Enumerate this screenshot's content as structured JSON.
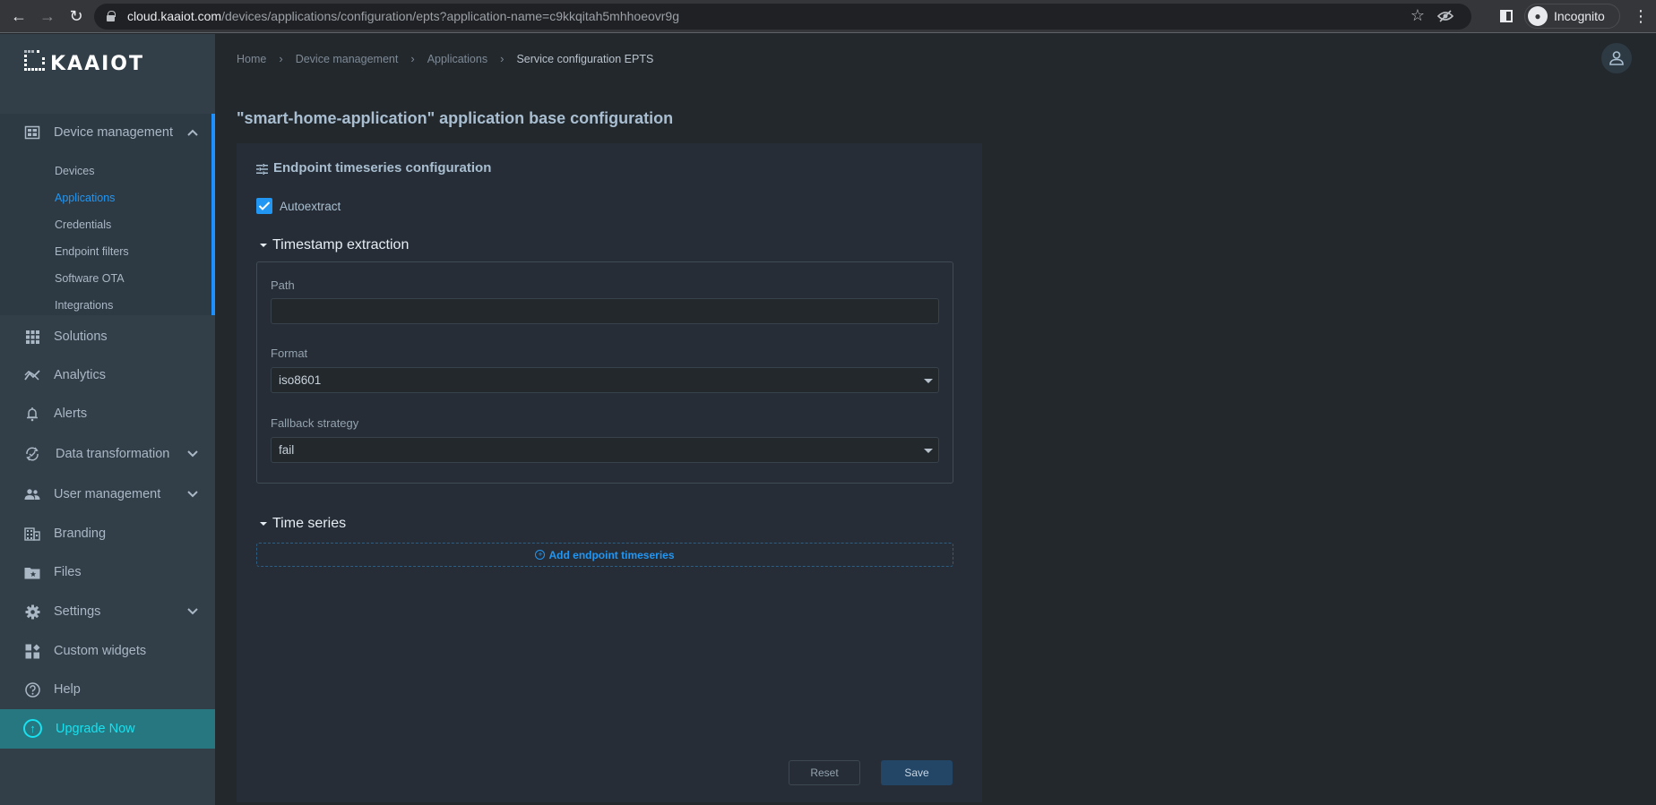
{
  "browser": {
    "url_host": "cloud.kaaiot.com",
    "url_path": "/devices/applications/configuration/epts?application-name=c9kkqitah5mhhoeovr9g",
    "profile_label": "Incognito"
  },
  "logo": {
    "text": "KAAIOT"
  },
  "sidebar": {
    "device_management": {
      "label": "Device management",
      "expanded": true,
      "children": [
        {
          "label": "Devices",
          "active": false
        },
        {
          "label": "Applications",
          "active": true
        },
        {
          "label": "Credentials",
          "active": false
        },
        {
          "label": "Endpoint filters",
          "active": false
        },
        {
          "label": "Software OTA",
          "active": false
        },
        {
          "label": "Integrations",
          "active": false
        }
      ]
    },
    "items": [
      {
        "label": "Solutions",
        "icon": "grid-icon",
        "has_children": false
      },
      {
        "label": "Analytics",
        "icon": "analytics-icon",
        "has_children": false
      },
      {
        "label": "Alerts",
        "icon": "bell-icon",
        "has_children": false
      },
      {
        "label": "Data transformation",
        "icon": "sync-check-icon",
        "has_children": true
      },
      {
        "label": "User management",
        "icon": "users-icon",
        "has_children": true
      },
      {
        "label": "Branding",
        "icon": "building-icon",
        "has_children": false
      },
      {
        "label": "Files",
        "icon": "folder-star-icon",
        "has_children": false
      },
      {
        "label": "Settings",
        "icon": "gear-icon",
        "has_children": true
      },
      {
        "label": "Custom widgets",
        "icon": "widgets-icon",
        "has_children": false
      },
      {
        "label": "Help",
        "icon": "help-icon",
        "has_children": false
      }
    ],
    "upgrade": {
      "label": "Upgrade Now"
    }
  },
  "breadcrumb": [
    "Home",
    "Device management",
    "Applications",
    "Service configuration EPTS"
  ],
  "page": {
    "title": "\"smart-home-application\" application base configuration"
  },
  "card": {
    "title": "Endpoint timeseries configuration",
    "autoextract": {
      "label": "Autoextract",
      "checked": true
    },
    "timestamp_section": {
      "title": "Timestamp extraction",
      "path": {
        "label": "Path",
        "value": ""
      },
      "format": {
        "label": "Format",
        "value": "iso8601"
      },
      "fallback": {
        "label": "Fallback strategy",
        "value": "fail"
      }
    },
    "timeseries_section": {
      "title": "Time series",
      "add_label": "Add endpoint timeseries"
    },
    "reset_label": "Reset",
    "save_label": "Save"
  },
  "colors": {
    "accent": "#2196f3",
    "upgrade_bg": "#26777f",
    "upgrade_fg": "#18e1f0",
    "sidebar_bg": "#323e48",
    "main_bg": "#23282d",
    "card_bg": "#262d36"
  }
}
